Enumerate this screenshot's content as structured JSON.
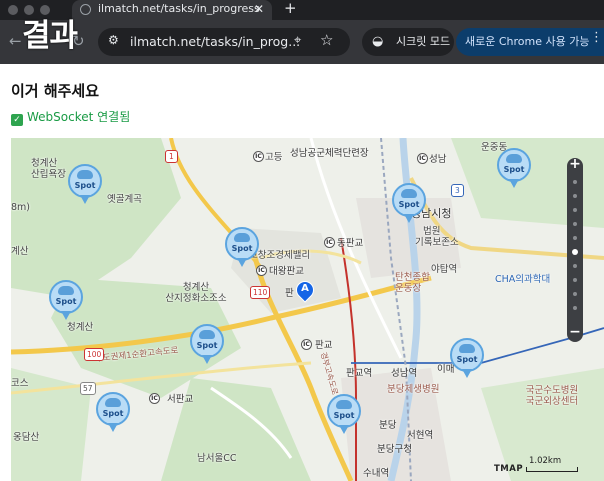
{
  "overlay_title": "결과",
  "browser": {
    "tab_title": "ilmatch.net/tasks/in_progress",
    "tab_close": "✕",
    "new_tab": "+",
    "back": "←",
    "reload": "↻",
    "url": "ilmatch.net/tasks/in_prog...",
    "incognito_label": "시크릿 모드",
    "upgrade_label": "새로운 Chrome 사용 가능",
    "menu": "⋮"
  },
  "page": {
    "heading": "이거 해주세요",
    "status_check": "✓",
    "status": "WebSocket 연결됨"
  },
  "map": {
    "labels": {
      "seongnam_arena": "성남공군체력단련장",
      "seongnam": "성남",
      "unjungdong": "운중동",
      "cheonggyesan_sanrip": "청계산\n산립욕장",
      "yetgolgyegok": "옛골계곡",
      "m8": "8m)",
      "gyesan": "계산",
      "seongnam_sicheong": "성남시청",
      "beobwon": "법원",
      "girokbojonso": "기록보존소",
      "dongpangyo": "동판교",
      "godeung": "고등",
      "daewang_pangyo": "대왕판교",
      "gochang_jugyejeol": "교창조경제밸리",
      "pan": "판",
      "yatap": "야탑역",
      "tancheon": "탄천종합\n운동장",
      "cha_hospital": "CHA의과학대",
      "cheonggyesan_sanji": "청계산\n산지정화소조소",
      "cheonggyesan2": "청계산",
      "pangyo": "판교",
      "pangyo_station": "판교역",
      "seongnam_station": "성남역",
      "imae": "이매",
      "sudogwon": "수도권제1순환고속도로",
      "kos": "코스",
      "seopangyo": "서판교",
      "bundang_hospital": "분당제생병원",
      "army_hospital": "국군수도병원\n국군외상센터",
      "ongdan": "옹담산",
      "namseoul": "남서울CC",
      "gyeongbu": "경부고속도로",
      "bundang": "분당",
      "seohyeon": "서현역",
      "bundanggu": "분당구청",
      "sunae": "수내역",
      "road_110": "110",
      "road_100": "100",
      "road_57": "57",
      "road_1": "1",
      "road_3": "3"
    },
    "ic": "IC",
    "spot_label": "Spot",
    "marker_letter": "A",
    "zoom_plus": "+",
    "zoom_minus": "−",
    "brand": "TMAP",
    "scale": "1.02km"
  }
}
